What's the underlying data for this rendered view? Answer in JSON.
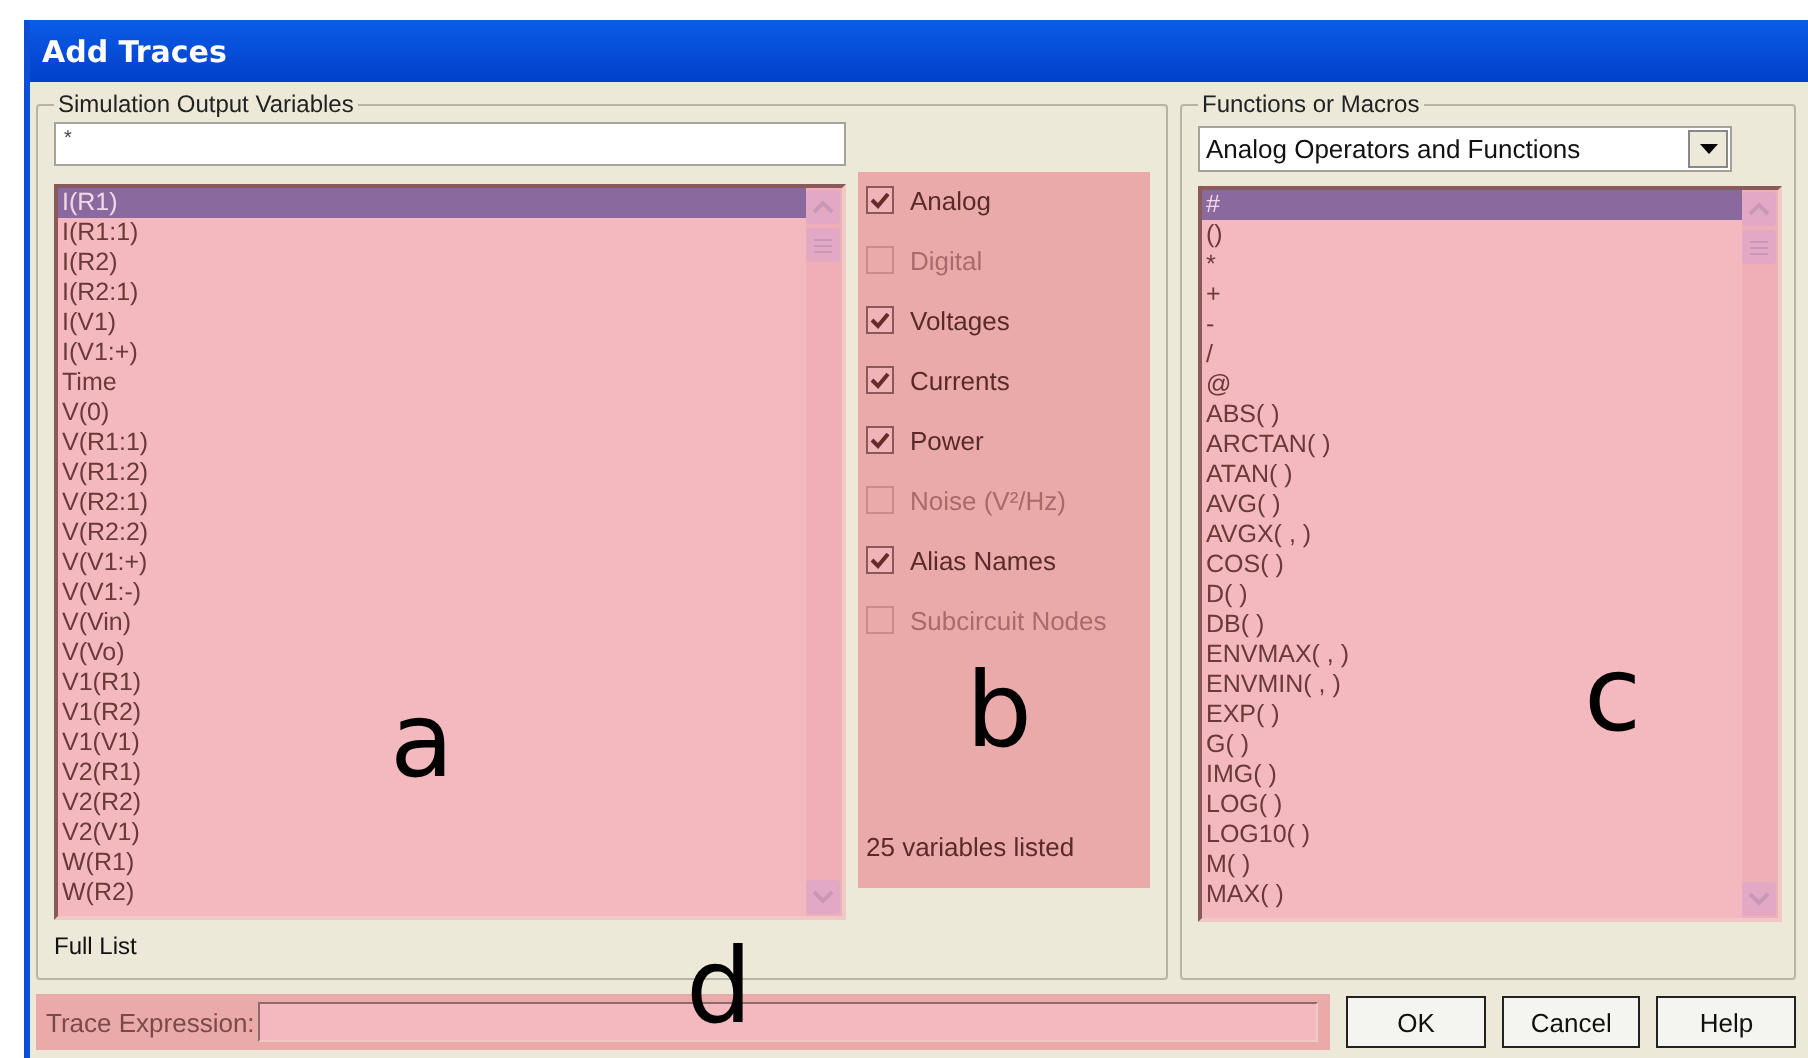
{
  "window": {
    "title": "Add Traces"
  },
  "output_variables": {
    "legend": "Simulation Output Variables",
    "filter": "*",
    "items": [
      {
        "label": "I(R1)",
        "selected": true
      },
      {
        "label": "I(R1:1)",
        "selected": false
      },
      {
        "label": "I(R2)",
        "selected": false
      },
      {
        "label": "I(R2:1)",
        "selected": false
      },
      {
        "label": "I(V1)",
        "selected": false
      },
      {
        "label": "I(V1:+)",
        "selected": false
      },
      {
        "label": "Time",
        "selected": false
      },
      {
        "label": "V(0)",
        "selected": false
      },
      {
        "label": "V(R1:1)",
        "selected": false
      },
      {
        "label": "V(R1:2)",
        "selected": false
      },
      {
        "label": "V(R2:1)",
        "selected": false
      },
      {
        "label": "V(R2:2)",
        "selected": false
      },
      {
        "label": "V(V1:+)",
        "selected": false
      },
      {
        "label": "V(V1:-)",
        "selected": false
      },
      {
        "label": "V(Vin)",
        "selected": false
      },
      {
        "label": "V(Vo)",
        "selected": false
      },
      {
        "label": "V1(R1)",
        "selected": false
      },
      {
        "label": "V1(R2)",
        "selected": false
      },
      {
        "label": "V1(V1)",
        "selected": false
      },
      {
        "label": "V2(R1)",
        "selected": false
      },
      {
        "label": "V2(R2)",
        "selected": false
      },
      {
        "label": "V2(V1)",
        "selected": false
      },
      {
        "label": "W(R1)",
        "selected": false
      },
      {
        "label": "W(R2)",
        "selected": false
      }
    ],
    "status": "Full List"
  },
  "filters": {
    "options": [
      {
        "label": "Analog",
        "checked": true,
        "disabled": false
      },
      {
        "label": "Digital",
        "checked": false,
        "disabled": true
      },
      {
        "label": "Voltages",
        "checked": true,
        "disabled": false
      },
      {
        "label": "Currents",
        "checked": true,
        "disabled": false
      },
      {
        "label": "Power",
        "checked": true,
        "disabled": false
      },
      {
        "label": "Noise (V²/Hz)",
        "checked": false,
        "disabled": true
      },
      {
        "label": "Alias Names",
        "checked": true,
        "disabled": false
      },
      {
        "label": "Subcircuit Nodes",
        "checked": false,
        "disabled": true
      }
    ],
    "count": "25 variables listed"
  },
  "functions": {
    "legend": "Functions or Macros",
    "category": "Analog Operators and Functions",
    "items": [
      {
        "label": "#",
        "selected": true
      },
      {
        "label": "()",
        "selected": false
      },
      {
        "label": "*",
        "selected": false
      },
      {
        "label": "+",
        "selected": false
      },
      {
        "label": "-",
        "selected": false
      },
      {
        "label": "/",
        "selected": false
      },
      {
        "label": "@",
        "selected": false
      },
      {
        "label": "ABS( )",
        "selected": false
      },
      {
        "label": "ARCTAN( )",
        "selected": false
      },
      {
        "label": "ATAN( )",
        "selected": false
      },
      {
        "label": "AVG( )",
        "selected": false
      },
      {
        "label": "AVGX( , )",
        "selected": false
      },
      {
        "label": "COS( )",
        "selected": false
      },
      {
        "label": "D( )",
        "selected": false
      },
      {
        "label": "DB( )",
        "selected": false
      },
      {
        "label": "ENVMAX( , )",
        "selected": false
      },
      {
        "label": "ENVMIN( , )",
        "selected": false
      },
      {
        "label": "EXP( )",
        "selected": false
      },
      {
        "label": "G( )",
        "selected": false
      },
      {
        "label": "IMG( )",
        "selected": false
      },
      {
        "label": "LOG( )",
        "selected": false
      },
      {
        "label": "LOG10( )",
        "selected": false
      },
      {
        "label": "M( )",
        "selected": false
      },
      {
        "label": "MAX( )",
        "selected": false
      }
    ]
  },
  "trace_expression": {
    "label": "Trace Expression:"
  },
  "buttons": [
    "OK",
    "Cancel",
    "Help"
  ],
  "annotations": [
    "a",
    "b",
    "c",
    "d"
  ]
}
